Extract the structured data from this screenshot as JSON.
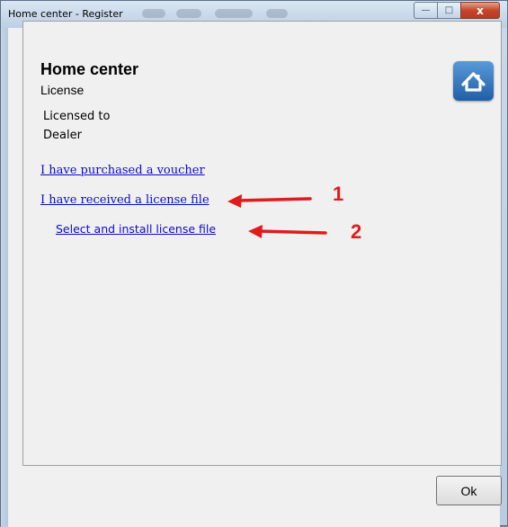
{
  "window": {
    "title": "Home center - Register",
    "close_glyph": "x",
    "min_glyph": "—",
    "max_glyph": "□"
  },
  "header": {
    "app_title": "Home center",
    "subtitle": "License"
  },
  "license": {
    "label": "Licensed to",
    "value": "Dealer"
  },
  "links": {
    "voucher": "I have purchased a voucher",
    "received": "I have received a license file",
    "select_install": "Select and install license file"
  },
  "annotations": {
    "marker_1": "1",
    "marker_2": "2"
  },
  "footer": {
    "ok_label": "Ok"
  },
  "icons": {
    "home": "home-icon"
  },
  "colors": {
    "link": "#0b0bc8",
    "annotation": "#e01b1b",
    "icon_blue": "#2d6fb8"
  }
}
